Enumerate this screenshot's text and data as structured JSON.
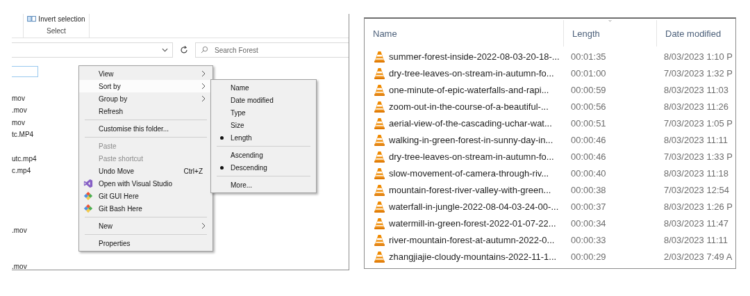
{
  "ribbon": {
    "button": "Invert selection",
    "group": "Select"
  },
  "search": {
    "placeholder": "Search Forest"
  },
  "file_rows": [
    {
      "kind": "visible",
      "name": "mov"
    },
    {
      "kind": "visible",
      "name": ".mov"
    },
    {
      "kind": "visible",
      "name": "mov"
    },
    {
      "kind": "visible",
      "name": "tc.MP4"
    },
    {
      "kind": "blank"
    },
    {
      "kind": "visible",
      "name": "utc.mp4"
    },
    {
      "kind": "visible",
      "name": "c.mp4"
    },
    {
      "kind": "blank"
    },
    {
      "kind": "blank"
    },
    {
      "kind": "blank"
    },
    {
      "kind": "blank"
    },
    {
      "kind": "visible",
      "name": ".mov"
    },
    {
      "kind": "blank"
    },
    {
      "kind": "blank"
    },
    {
      "kind": "visible",
      "name": ".mov"
    }
  ],
  "context_menu": {
    "items": [
      {
        "kind": "submenu",
        "label": "View",
        "selected": false
      },
      {
        "kind": "submenu",
        "label": "Sort by",
        "selected": true
      },
      {
        "kind": "submenu",
        "label": "Group by",
        "selected": false
      },
      {
        "kind": "command",
        "label": "Refresh",
        "selected": false,
        "disabled": false
      },
      {
        "kind": "separator"
      },
      {
        "kind": "command",
        "label": "Customise this folder...",
        "selected": false,
        "disabled": false
      },
      {
        "kind": "separator"
      },
      {
        "kind": "command",
        "label": "Paste",
        "selected": false,
        "disabled": true
      },
      {
        "kind": "command",
        "label": "Paste shortcut",
        "selected": false,
        "disabled": true
      },
      {
        "kind": "command",
        "label": "Undo Move",
        "shortcut": "Ctrl+Z",
        "selected": false,
        "disabled": false
      },
      {
        "kind": "studio",
        "label": "Open with Visual Studio",
        "selected": false,
        "disabled": false
      },
      {
        "kind": "git",
        "label": "Git GUI Here",
        "selected": false,
        "disabled": false
      },
      {
        "kind": "git",
        "label": "Git Bash Here",
        "selected": false,
        "disabled": false
      },
      {
        "kind": "separator"
      },
      {
        "kind": "submenu",
        "label": "New",
        "selected": false
      },
      {
        "kind": "separator"
      },
      {
        "kind": "command",
        "label": "Properties",
        "selected": false,
        "disabled": false
      }
    ]
  },
  "sort_menu": {
    "items": [
      {
        "kind": "option",
        "label": "Name",
        "checked": false
      },
      {
        "kind": "option",
        "label": "Date modified",
        "checked": false
      },
      {
        "kind": "option",
        "label": "Type",
        "checked": false
      },
      {
        "kind": "option",
        "label": "Size",
        "checked": false
      },
      {
        "kind": "option",
        "label": "Length",
        "checked": true
      },
      {
        "kind": "separator"
      },
      {
        "kind": "option",
        "label": "Ascending",
        "checked": false
      },
      {
        "kind": "option",
        "label": "Descending",
        "checked": true
      },
      {
        "kind": "separator"
      },
      {
        "kind": "option",
        "label": "More...",
        "checked": false
      }
    ]
  },
  "details": {
    "columns": [
      {
        "label": "Name",
        "sorted": false
      },
      {
        "label": "Length",
        "sorted": true
      },
      {
        "label": "Date modified",
        "sorted": false
      }
    ],
    "rows": [
      {
        "name": "summer-forest-inside-2022-08-03-20-18-...",
        "length": "00:01:35",
        "date": "8/03/2023 1:10 P"
      },
      {
        "name": "dry-tree-leaves-on-stream-in-autumn-fo...",
        "length": "00:01:00",
        "date": "7/03/2023 1:32 P"
      },
      {
        "name": "one-minute-of-epic-waterfalls-and-rapi...",
        "length": "00:00:59",
        "date": "8/03/2023 11:03"
      },
      {
        "name": "zoom-out-in-the-course-of-a-beautiful-...",
        "length": "00:00:56",
        "date": "8/03/2023 11:26"
      },
      {
        "name": "aerial-view-of-the-cascading-uchar-wat...",
        "length": "00:00:51",
        "date": "7/03/2023 1:05 P"
      },
      {
        "name": "walking-in-green-forest-in-sunny-day-in...",
        "length": "00:00:46",
        "date": "8/03/2023 11:11"
      },
      {
        "name": "dry-tree-leaves-on-stream-in-autumn-fo...",
        "length": "00:00:46",
        "date": "7/03/2023 1:33 P"
      },
      {
        "name": "slow-movement-of-camera-through-riv...",
        "length": "00:00:40",
        "date": "8/03/2023 11:18"
      },
      {
        "name": "mountain-forest-river-valley-with-green...",
        "length": "00:00:38",
        "date": "7/03/2023 12:54"
      },
      {
        "name": "waterfall-in-jungle-2022-08-04-03-24-00-...",
        "length": "00:00:37",
        "date": "8/03/2023 1:26 P"
      },
      {
        "name": "watermill-in-green-forest-2022-01-07-22...",
        "length": "00:00:34",
        "date": "8/03/2023 11:47"
      },
      {
        "name": "river-mountain-forest-at-autumn-2022-0...",
        "length": "00:00:33",
        "date": "8/03/2023 11:11"
      },
      {
        "name": "zhangjiajie-cloudy-mountains-2022-11-1...",
        "length": "00:00:29",
        "date": "2/03/2023 7:49 A"
      }
    ]
  }
}
